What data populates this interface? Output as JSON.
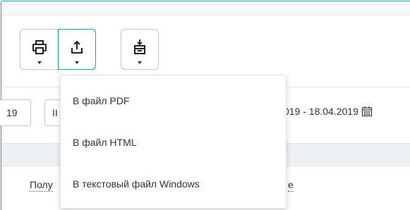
{
  "toolbar": {
    "print_icon": "printer-icon",
    "export_icon": "upload-icon",
    "archive_icon": "download-archive-icon"
  },
  "filters": {
    "year_fragment": "19",
    "middle_fragment": "II",
    "date_range_fragment": "019 - 18.04.2019",
    "calendar_icon": "calendar-icon"
  },
  "content": {
    "left_link_fragment": "Полу",
    "right_link_fragment": "е"
  },
  "export_menu": {
    "items": [
      {
        "label": "В файл PDF"
      },
      {
        "label": "В файл HTML"
      },
      {
        "label": "В текстовый файл Windows"
      }
    ]
  },
  "colors": {
    "accent": "#17a4a4",
    "border": "#c4c8cc",
    "text": "#333333"
  }
}
